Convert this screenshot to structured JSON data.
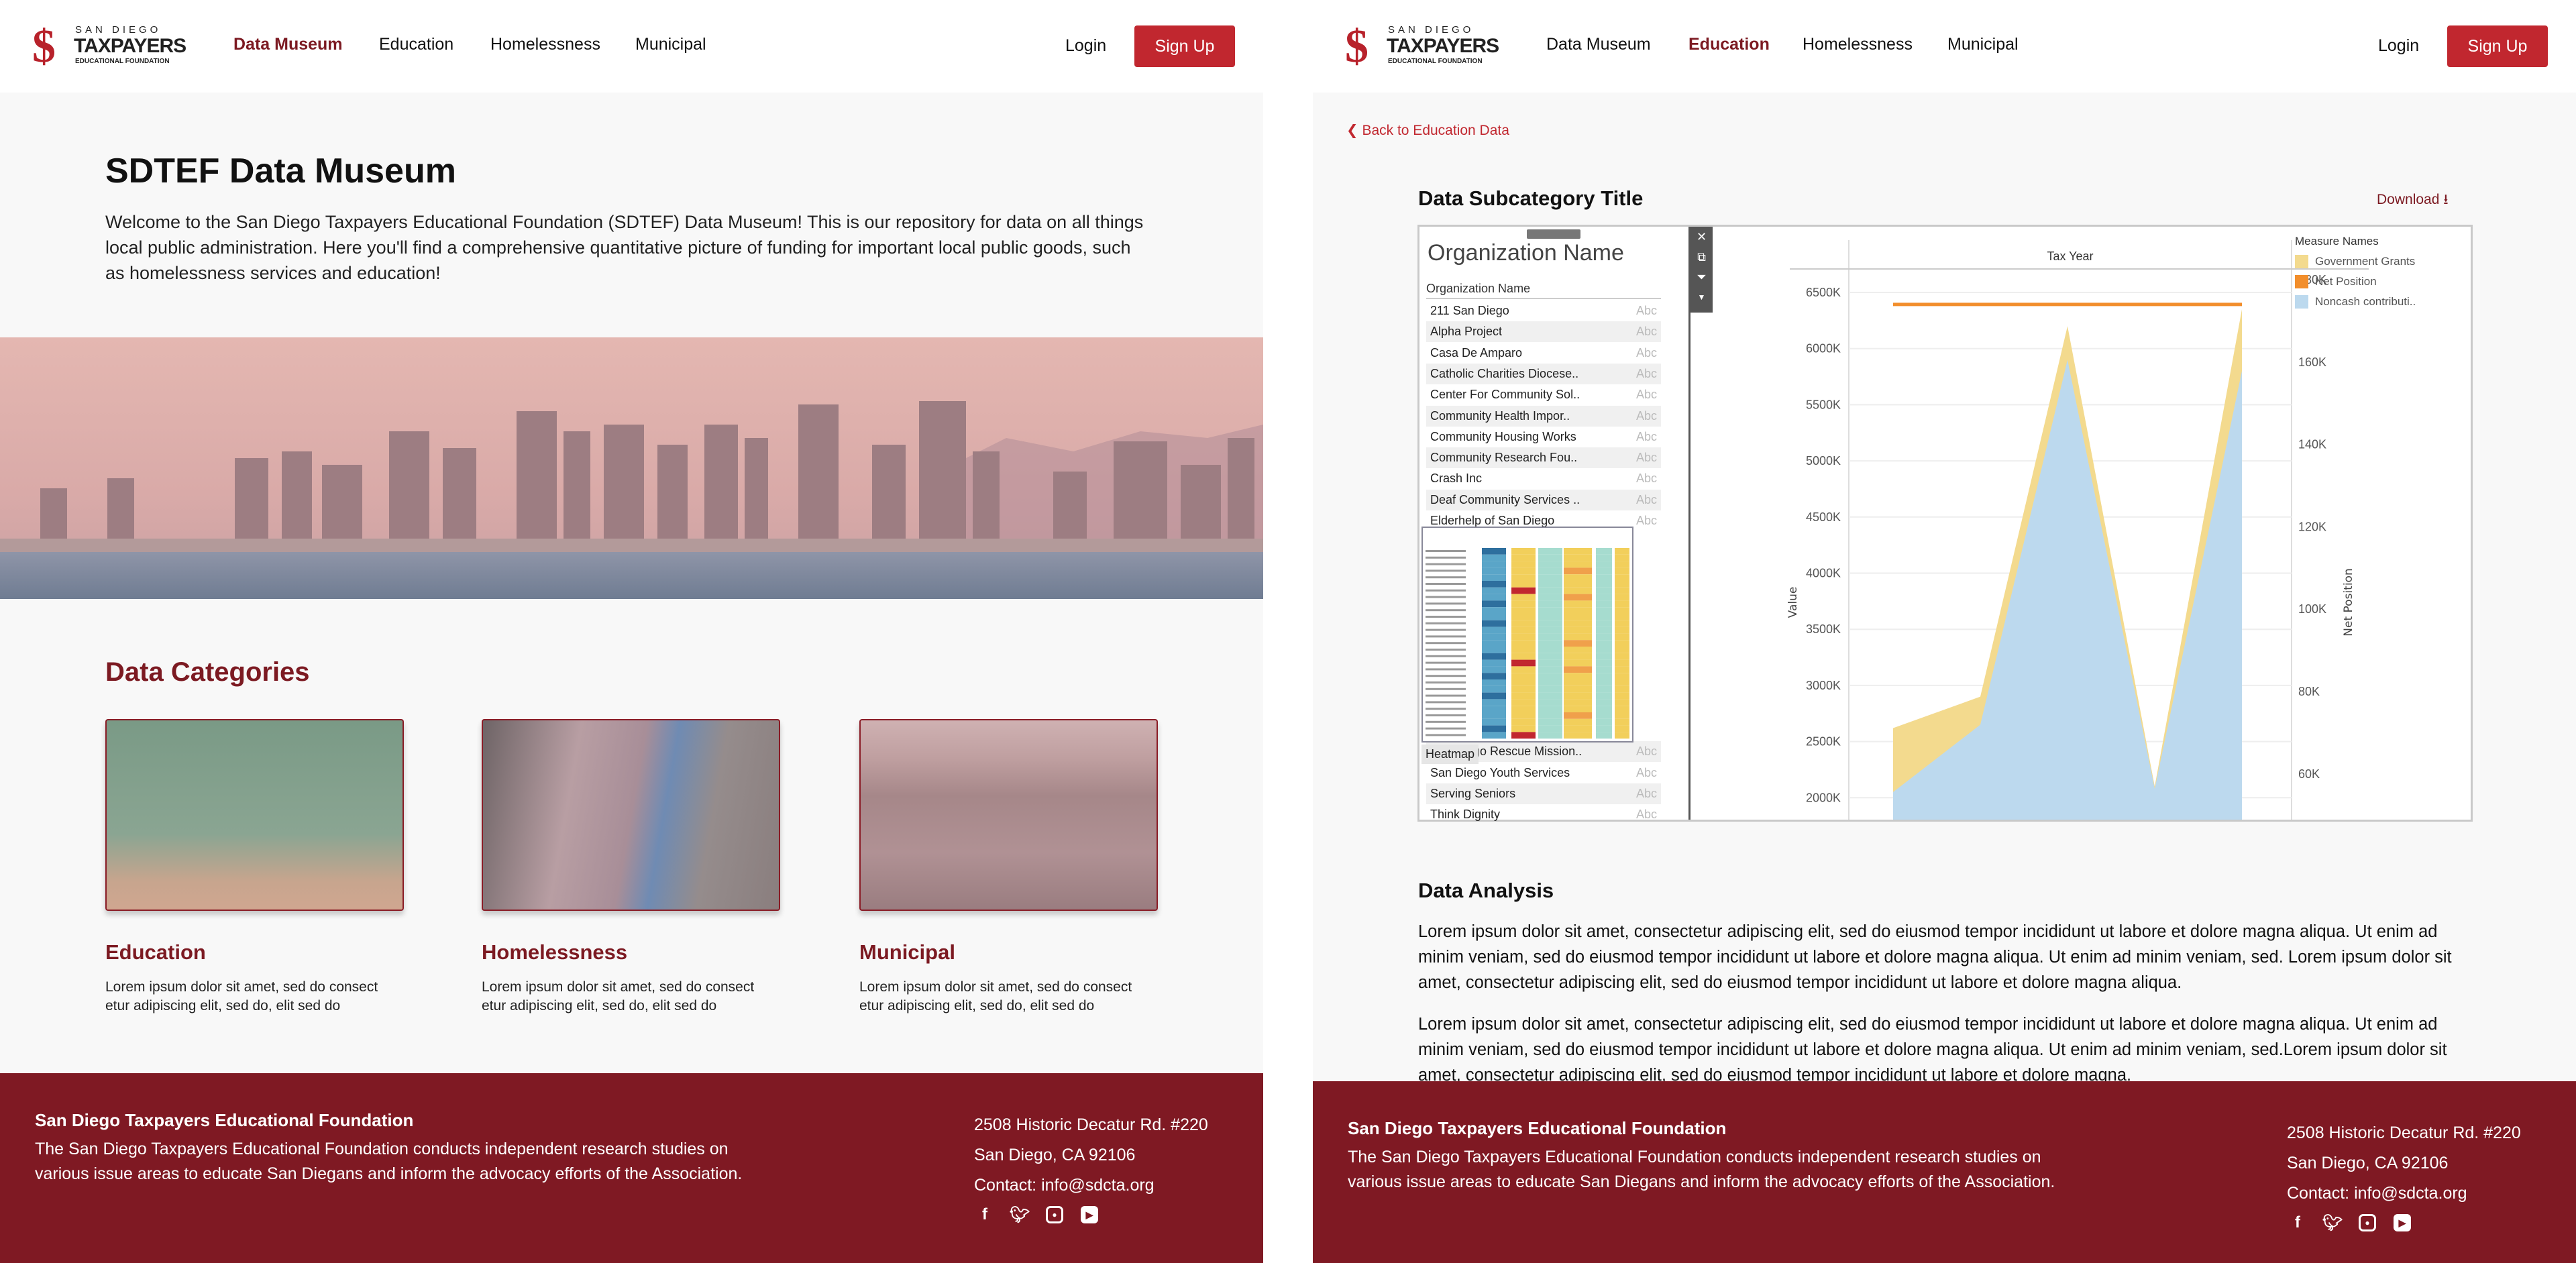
{
  "logo": {
    "line1": "SAN DIEGO",
    "line2": "TAXPAYERS",
    "line3": "EDUCATIONAL FOUNDATION",
    "symbol": "$"
  },
  "nav": {
    "items": [
      "Data Museum",
      "Education",
      "Homelessness",
      "Municipal"
    ],
    "login": "Login",
    "signup": "Sign Up"
  },
  "museum": {
    "title": "SDTEF Data Museum",
    "intro": "Welcome to the San Diego Taxpayers Educational Foundation (SDTEF) Data Museum! This is our repository for data on all things local public administration. Here you'll find a comprehensive quantitative picture of funding for important local public goods, such as homelessness services and education!",
    "categories_title": "Data Categories",
    "categories": [
      {
        "title": "Education",
        "desc": "Lorem ipsum dolor sit amet, sed do consect etur adipiscing elit, sed do, elit sed do"
      },
      {
        "title": "Homelessness",
        "desc": "Lorem ipsum dolor sit amet, sed do consect etur adipiscing elit, sed do, elit sed do"
      },
      {
        "title": "Municipal",
        "desc": "Lorem ipsum dolor sit amet, sed do consect etur adipiscing elit, sed do, elit sed do"
      }
    ]
  },
  "detail": {
    "back": "Back to Education Data",
    "title": "Data Subcategory Title",
    "download": "Download",
    "analysis_title": "Data Analysis",
    "para1": "Lorem ipsum dolor sit amet, consectetur adipiscing elit, sed do eiusmod tempor incididunt ut labore et dolore magna aliqua. Ut enim ad minim veniam, sed do eiusmod tempor incididunt ut labore et dolore magna aliqua. Ut enim ad minim veniam, sed. Lorem ipsum dolor sit amet, consectetur adipiscing elit, sed do eiusmod tempor incididunt ut labore et dolore magna aliqua.",
    "para2": "Lorem ipsum dolor sit amet, consectetur adipiscing elit, sed do eiusmod tempor incididunt ut labore et dolore magna aliqua. Ut enim ad minim veniam, sed do eiusmod tempor incididunt ut labore et dolore magna aliqua. Ut enim ad minim veniam, sed.Lorem ipsum dolor sit amet, consectetur adipiscing elit, sed do eiusmod tempor incididunt ut labore et dolore magna."
  },
  "dashboard": {
    "org_title": "Organization Name",
    "org_header": "Organization Name",
    "abc": "Abc",
    "orgs_top": [
      "211 San Diego",
      "Alpha Project",
      "Casa De Amparo",
      "Catholic Charities Diocese..",
      "Center For Community Sol..",
      "Community Health Impor..",
      "Community Housing Works",
      "Community Research Fou..",
      "Crash Inc",
      "Deaf Community Services ..",
      "Elderhelp of San Diego"
    ],
    "orgs_bottom": [
      "San Diego Rescue Mission..",
      "San Diego Youth Services",
      "Serving Seniors",
      "Think Dignity"
    ],
    "heatmap_label": "Heatmap",
    "heatmap_palette": [
      "#2e6f9e",
      "#5aa5c8",
      "#a6dccf",
      "#f2cf5b",
      "#f0a04b",
      "#c1272f"
    ]
  },
  "chart_data": {
    "type": "area",
    "title": "",
    "xlabel": "Tax Year",
    "ylabel": "Value",
    "y2label": "Net Position",
    "ylim": [
      1800,
      6700
    ],
    "y_ticks": [
      "2000K",
      "2500K",
      "3000K",
      "3500K",
      "4000K",
      "4500K",
      "5000K",
      "5500K",
      "6000K",
      "6500K"
    ],
    "y2lim": [
      44,
      186
    ],
    "y2_ticks": [
      "60K",
      "80K",
      "100K",
      "120K",
      "140K",
      "160K",
      "180K"
    ],
    "grid": true,
    "stacked": true,
    "legend_title": "Measure Names",
    "legend_position": "right",
    "series": [
      {
        "name": "Noncash contributi..",
        "color": "#bcd9ee",
        "values": [
          2050,
          2650,
          5900,
          2080,
          5800
        ]
      },
      {
        "name": "Government Grants",
        "color": "#f3da8e",
        "values": [
          570,
          250,
          300,
          20,
          550
        ]
      },
      {
        "name": "Net Position",
        "color": "#f28e2b",
        "axis": "right",
        "type": "line",
        "values": [
          174,
          174,
          174,
          174,
          174
        ]
      }
    ]
  },
  "footer": {
    "title": "San Diego Taxpayers Educational Foundation",
    "desc": "The San Diego Taxpayers Educational Foundation conducts independent research studies on various issue areas to educate San Diegans and inform the advocacy efforts of the Association.",
    "addr1": "2508 Historic Decatur Rd. #220",
    "addr2": "San Diego, CA 92106",
    "contact_label": "Contact: ",
    "email": "info@sdcta.org",
    "social": [
      "facebook-icon",
      "twitter-icon",
      "instagram-icon",
      "youtube-icon"
    ]
  },
  "colors": {
    "brand": "#7f1923",
    "accent": "#c1272f",
    "bg": "#f8f8f8"
  }
}
